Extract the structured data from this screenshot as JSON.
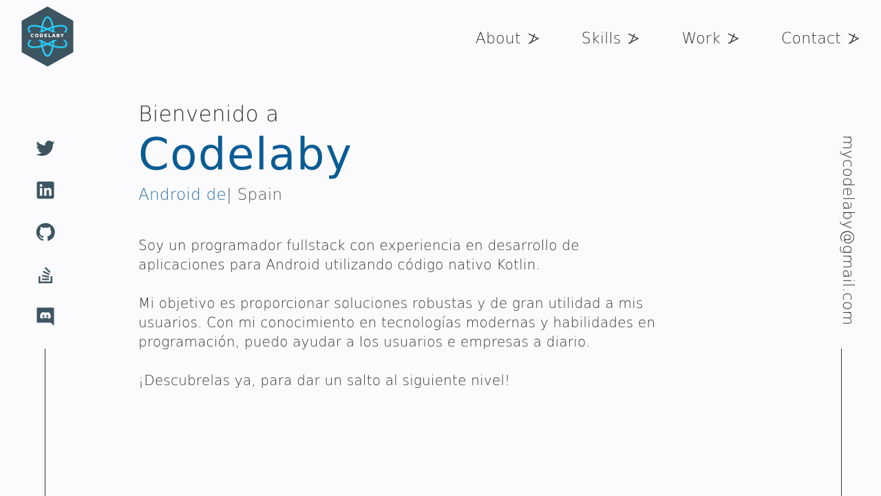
{
  "logo": {
    "text": "CODELABY",
    "bg_color": "#3d5560",
    "accent_color": "#29c6ef"
  },
  "nav": {
    "items": [
      {
        "label": "About",
        "icon": "arrow-icon"
      },
      {
        "label": "Skills",
        "icon": "arrow-icon"
      },
      {
        "label": "Work",
        "icon": "arrow-icon"
      },
      {
        "label": "Contact",
        "icon": "arrow-icon"
      }
    ]
  },
  "social": [
    "twitter-icon",
    "linkedin-icon",
    "github-icon",
    "stackoverflow-icon",
    "discord-icon"
  ],
  "email": "mycodelaby@gmail.com",
  "hero": {
    "welcome": "Bienvenido a",
    "brand": "Codelaby",
    "role_typed": "Android de",
    "role_separator": "|",
    "role_location": " Spain",
    "paragraphs": [
      "Soy un programador fullstack con experiencia en desarrollo de aplicaciones para Android utilizando código nativo Kotlin.",
      "Mi objetivo es proporcionar soluciones robustas y de gran utilidad a mis usuarios. Con mi conocimiento en tecnologías modernas y habilidades en programación, puedo ayudar a los usuarios e empresas a diario.",
      "¡Descubrelas ya, para dar un salto al siguiente nivel!"
    ]
  },
  "colors": {
    "brand": "#0a5c94",
    "text": "#333333",
    "background": "#fbfbfe"
  }
}
